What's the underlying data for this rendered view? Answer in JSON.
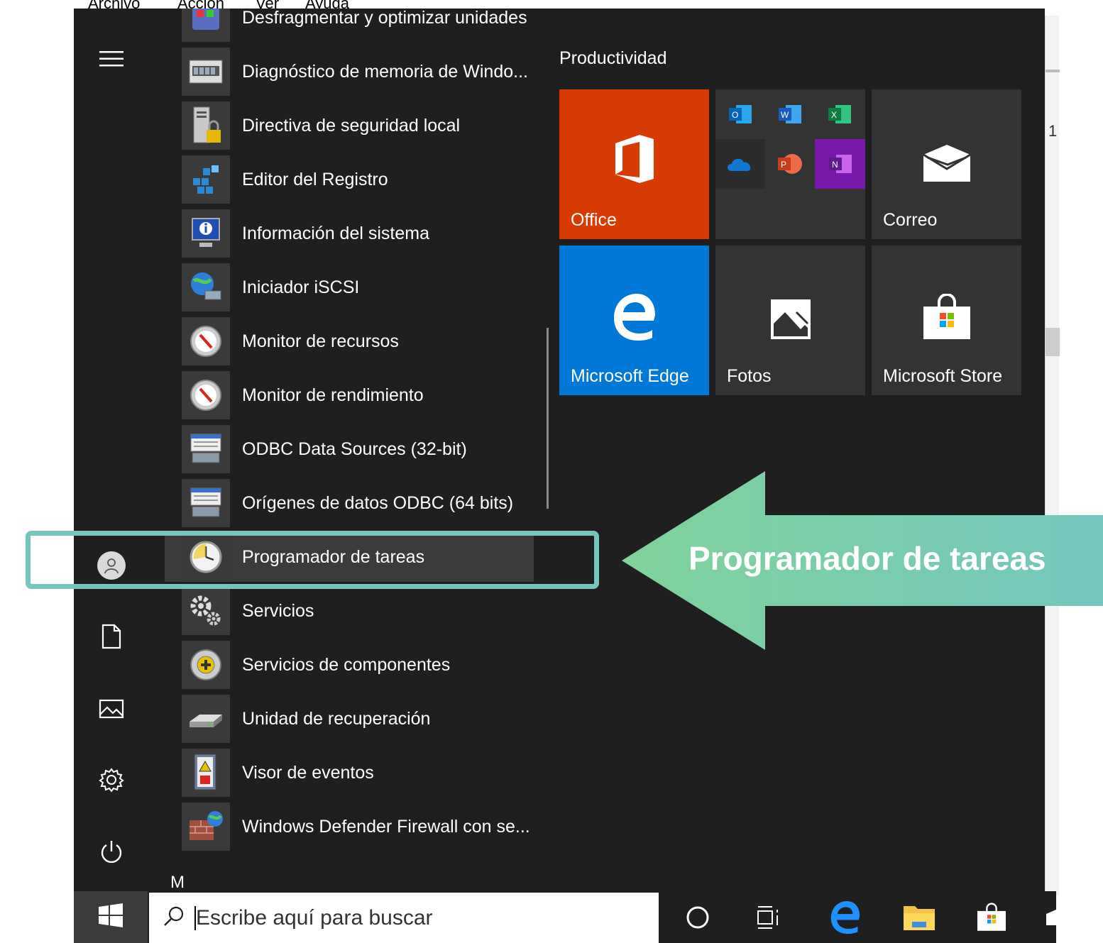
{
  "background_app": {
    "menu": [
      "Archivo",
      "Acción",
      "Ver",
      "Ayuda"
    ],
    "right_number": "1"
  },
  "rail": {
    "menu_icon": "hamburger-icon",
    "user_icon": "user-icon",
    "documents_icon": "document-icon",
    "pictures_icon": "pictures-icon",
    "settings_icon": "gear-icon",
    "power_icon": "power-icon"
  },
  "app_list": {
    "items": [
      {
        "label": "Desfragmentar y optimizar unidades",
        "icon": "defrag-icon"
      },
      {
        "label": "Diagnóstico de memoria de Windo...",
        "icon": "memory-diagnostic-icon"
      },
      {
        "label": "Directiva de seguridad local",
        "icon": "security-policy-icon"
      },
      {
        "label": "Editor del Registro",
        "icon": "registry-editor-icon"
      },
      {
        "label": "Información del sistema",
        "icon": "system-info-icon"
      },
      {
        "label": "Iniciador iSCSI",
        "icon": "iscsi-icon"
      },
      {
        "label": "Monitor de recursos",
        "icon": "resource-monitor-icon"
      },
      {
        "label": "Monitor de rendimiento",
        "icon": "performance-monitor-icon"
      },
      {
        "label": "ODBC Data Sources (32-bit)",
        "icon": "odbc-icon"
      },
      {
        "label": "Orígenes de datos ODBC (64 bits)",
        "icon": "odbc-icon"
      },
      {
        "label": "Programador de tareas",
        "icon": "clock-icon",
        "highlighted": true
      },
      {
        "label": "Servicios",
        "icon": "services-gears-icon"
      },
      {
        "label": "Servicios de componentes",
        "icon": "component-services-icon"
      },
      {
        "label": "Unidad de recuperación",
        "icon": "recovery-drive-icon"
      },
      {
        "label": "Visor de eventos",
        "icon": "event-viewer-icon"
      },
      {
        "label": "Windows Defender Firewall con se...",
        "icon": "firewall-icon"
      }
    ],
    "next_letter": "M"
  },
  "tiles": {
    "group_title": "Productividad",
    "office": {
      "label": "Office",
      "color": "#d83b01"
    },
    "office_apps": {
      "color": "#333333",
      "onenote_color": "#7719aa"
    },
    "mail": {
      "label": "Correo",
      "color": "#333333"
    },
    "edge": {
      "label": "Microsoft Edge",
      "color": "#0078d7"
    },
    "photos": {
      "label": "Fotos",
      "color": "#333333"
    },
    "store": {
      "label": "Microsoft Store",
      "color": "#333333"
    }
  },
  "taskbar": {
    "start_icon": "windows-logo-icon",
    "search_placeholder": "Escribe aquí para buscar",
    "icons": [
      "cortana-circle-icon",
      "task-view-icon",
      "edge-icon",
      "file-explorer-icon",
      "store-icon"
    ]
  },
  "callout": {
    "text": "Programador de tareas",
    "color": "#74c6bf"
  }
}
